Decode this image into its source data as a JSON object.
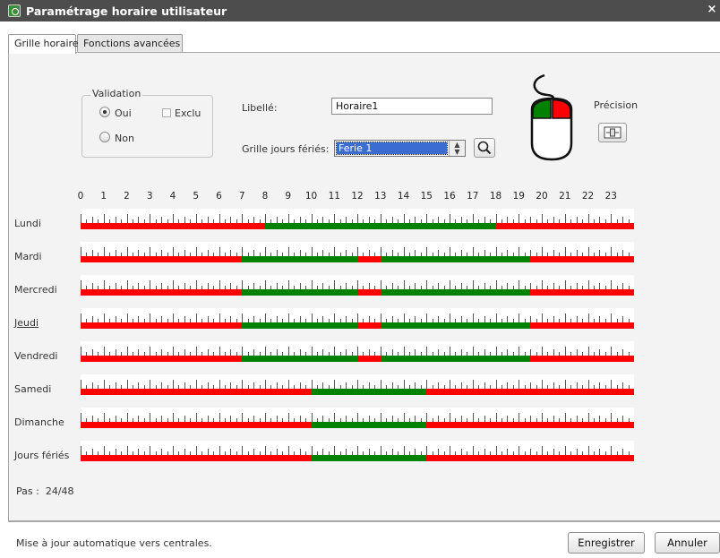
{
  "window": {
    "title": "Paramétrage horaire utilisateur",
    "close_glyph": "×"
  },
  "tabs": [
    {
      "label": "Grille horaire",
      "active": true
    },
    {
      "label": "Fonctions avancées",
      "active": false
    }
  ],
  "validation": {
    "legend": "Validation",
    "oui_label": "Oui",
    "oui_checked": true,
    "non_label": "Non",
    "non_checked": false,
    "exclu_label": "Exclu",
    "exclu_checked": false
  },
  "libelle": {
    "label": "Libellé:",
    "value": "Horaire1"
  },
  "grille_feries": {
    "label": "Grille jours fériés:",
    "selected": "Ferie 1"
  },
  "mouse_icon": {
    "left_color": "#008200",
    "right_color": "#fd0000"
  },
  "precision": {
    "label": "Précision"
  },
  "hours": [
    "0",
    "1",
    "2",
    "3",
    "4",
    "5",
    "6",
    "7",
    "8",
    "9",
    "10",
    "11",
    "12",
    "13",
    "14",
    "15",
    "16",
    "17",
    "18",
    "19",
    "20",
    "21",
    "22",
    "23"
  ],
  "colors": {
    "active": "#008200",
    "inactive": "#fd0000"
  },
  "days": [
    {
      "label": "Lundi",
      "underlined": false,
      "active_ranges": [
        [
          8,
          18
        ]
      ]
    },
    {
      "label": "Mardi",
      "underlined": false,
      "active_ranges": [
        [
          7,
          12
        ],
        [
          13,
          19.5
        ]
      ]
    },
    {
      "label": "Mercredi",
      "underlined": false,
      "active_ranges": [
        [
          7,
          12
        ],
        [
          13,
          19.5
        ]
      ]
    },
    {
      "label": "Jeudi",
      "underlined": true,
      "active_ranges": [
        [
          7,
          12
        ],
        [
          13,
          19.5
        ]
      ]
    },
    {
      "label": "Vendredi",
      "underlined": false,
      "active_ranges": [
        [
          7,
          12
        ],
        [
          13,
          19.5
        ]
      ]
    },
    {
      "label": "Samedi",
      "underlined": false,
      "active_ranges": [
        [
          10,
          15
        ]
      ]
    },
    {
      "label": "Dimanche",
      "underlined": false,
      "active_ranges": [
        [
          10,
          15
        ]
      ]
    },
    {
      "label": "Jours fériés",
      "underlined": false,
      "active_ranges": [
        [
          10,
          15
        ]
      ]
    }
  ],
  "pas": {
    "label": "Pas :",
    "value": "24/48"
  },
  "status": {
    "text": "Mise à jour automatique vers centrales."
  },
  "buttons": {
    "save": "Enregistrer",
    "cancel": "Annuler"
  }
}
